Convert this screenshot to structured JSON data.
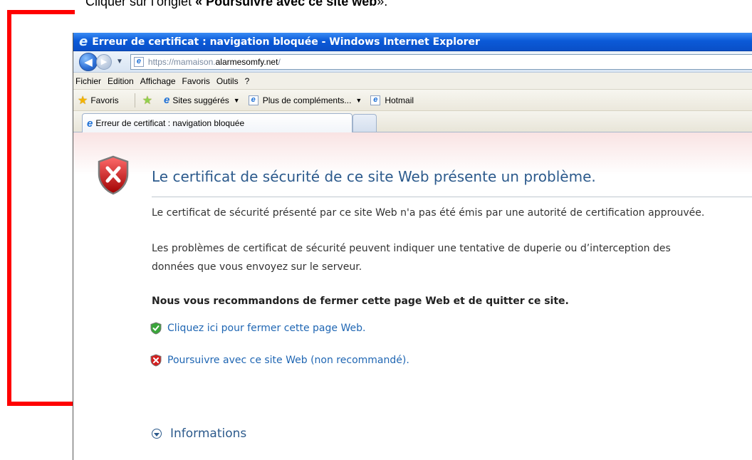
{
  "instruction": {
    "prefix": "Cliquer sur l’onglet ",
    "emphasis": "« Poursuivre avec ce site web",
    "suffix": "»."
  },
  "window": {
    "title": "Erreur de certificat : navigation bloquée - Windows Internet Explorer"
  },
  "address": {
    "url_scheme": "https://mamaison.",
    "url_host": "alarmesomfy.net",
    "url_tail": "/"
  },
  "menu": [
    "Fichier",
    "Edition",
    "Affichage",
    "Favoris",
    "Outils",
    "?"
  ],
  "favorites": {
    "favoris_label": "Favoris",
    "sites_suggested": "Sites suggérés",
    "more_addons": "Plus de compléments...",
    "hotmail": "Hotmail"
  },
  "tab": {
    "label": "Erreur de certificat : navigation bloquée"
  },
  "page": {
    "heading": "Le certificat de sécurité de ce site Web présente un problème.",
    "para1": "Le certificat de sécurité présenté par ce site Web n'a pas été émis par une autorité de certification approuvée.",
    "para2_line1": "Les problèmes de certificat de sécurité peuvent indiquer une tentative de duperie ou d’interception des",
    "para2_line2": "données que vous envoyez sur le serveur.",
    "recommendation": "Nous vous recommandons de fermer cette page Web et de quitter ce site.",
    "close_link": "Cliquez ici pour fermer cette page Web.",
    "continue_link": "Poursuivre avec ce site Web (non recommandé).",
    "info_label": "Informations"
  },
  "colors": {
    "annotation": "#ff0000",
    "titlebar": "#0b5ad8",
    "heading": "#2c5a8c",
    "link": "#1f66b3"
  }
}
